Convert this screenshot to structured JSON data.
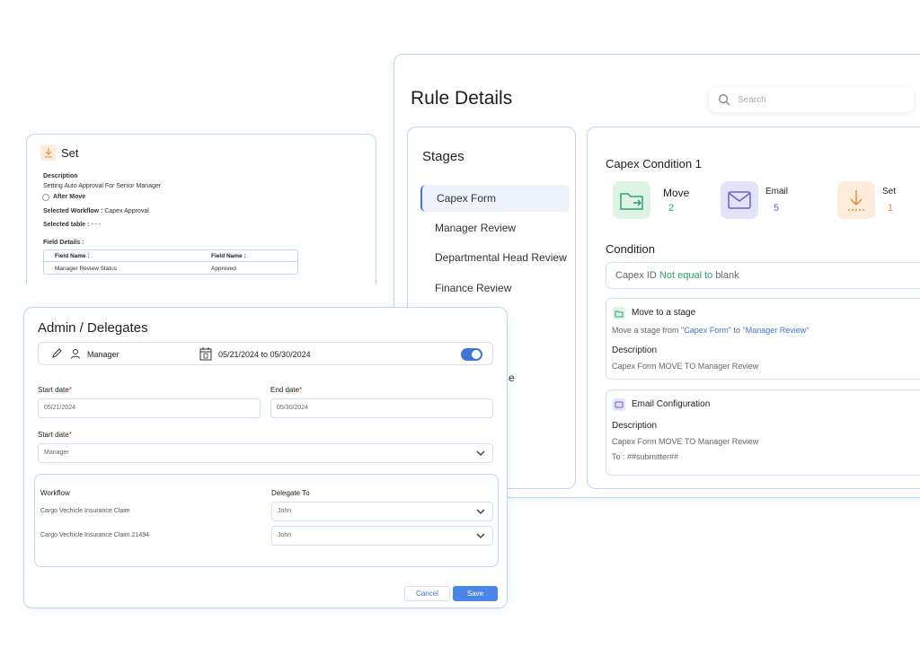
{
  "rule_details": {
    "title": "Rule Details",
    "search_placeholder": "Search",
    "stages": {
      "title": "Stages",
      "items": [
        "Capex Form",
        "Manager Review",
        "Departmental Head Review",
        "Finance Review"
      ],
      "partial_item_suffix": "e"
    },
    "condition_panel": {
      "title": "Capex Condition 1",
      "actions": [
        {
          "label": "Move",
          "count": "2",
          "color": "#2fa56b"
        },
        {
          "label": "Email",
          "count": "5",
          "color": "#6a5fd3"
        },
        {
          "label": "Set",
          "count": "1",
          "color": "#e58a3a"
        }
      ],
      "condition_heading": "Condition",
      "condition": {
        "field": "Capex ID",
        "operator": "Not equal to",
        "value": "blank"
      },
      "move_block": {
        "title": "Move to a stage",
        "text_prefix": "Move a stage from",
        "from": "\"Capex Form\"",
        "to_word": "to",
        "to": "\"Manager Review\"",
        "description_label": "Description",
        "description": "Capex Form MOVE TO Manager Review"
      },
      "email_block": {
        "title": "Email Configuration",
        "description_label": "Description",
        "description": "Capex Form MOVE TO Manager Review",
        "to": "To : ##submitter##"
      }
    }
  },
  "set_panel": {
    "title": "Set",
    "description_label": "Description",
    "description": "Setting Auto Approval For Senior Manager",
    "after_move": "After Move",
    "selected_workflow_label": "Selected Workflow :",
    "selected_workflow": "Capex Approval",
    "selected_table_label": "Selected table :",
    "selected_table": "- - -",
    "field_details_label": "Field Details :",
    "table": {
      "headers": [
        "Field Name :",
        "Field Name :"
      ],
      "row": [
        "Manager Review Status",
        "Approved"
      ]
    }
  },
  "admin_panel": {
    "title": "Admin / Delegates",
    "bar_role": "Manager",
    "bar_dates": "05/21/2024 to 05/30/2024",
    "toggle_on": true,
    "start_date_label": "Start date",
    "start_date_value": "05/21/2024",
    "end_date_label": "End date",
    "end_date_value": "05/30/2024",
    "role_label": "Start date",
    "role_value": "Manager",
    "workflow_header": "Workflow",
    "delegate_header": "Delegate To",
    "rows": [
      {
        "workflow": "Cargo Vechicle Insurance Claim",
        "delegate": "John"
      },
      {
        "workflow": "Cargo Vechicle Insurance Claim 21494",
        "delegate": "John"
      }
    ],
    "cancel": "Cancel",
    "save": "Save"
  },
  "colors": {
    "accent": "#3f74d8",
    "border": "#bcd6f2",
    "move": "#2fa56b",
    "email": "#6a5fd3",
    "set": "#e58a3a"
  }
}
